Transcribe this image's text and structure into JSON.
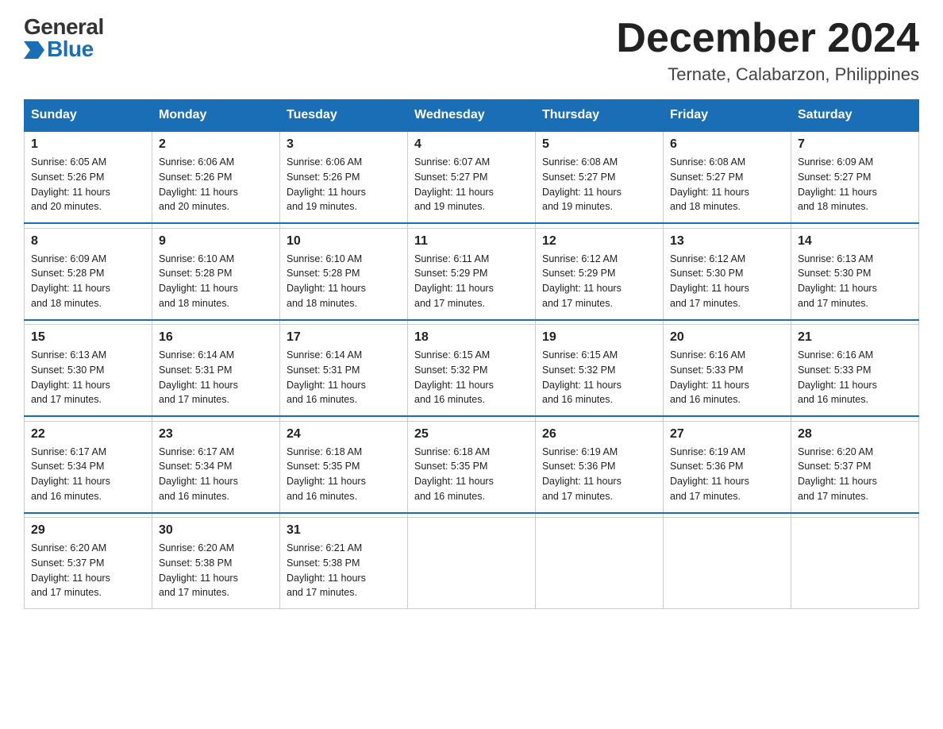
{
  "logo": {
    "general": "General",
    "blue": "Blue"
  },
  "title": "December 2024",
  "location": "Ternate, Calabarzon, Philippines",
  "days_of_week": [
    "Sunday",
    "Monday",
    "Tuesday",
    "Wednesday",
    "Thursday",
    "Friday",
    "Saturday"
  ],
  "weeks": [
    [
      {
        "num": "1",
        "sunrise": "6:05 AM",
        "sunset": "5:26 PM",
        "daylight": "11 hours and 20 minutes."
      },
      {
        "num": "2",
        "sunrise": "6:06 AM",
        "sunset": "5:26 PM",
        "daylight": "11 hours and 20 minutes."
      },
      {
        "num": "3",
        "sunrise": "6:06 AM",
        "sunset": "5:26 PM",
        "daylight": "11 hours and 19 minutes."
      },
      {
        "num": "4",
        "sunrise": "6:07 AM",
        "sunset": "5:27 PM",
        "daylight": "11 hours and 19 minutes."
      },
      {
        "num": "5",
        "sunrise": "6:08 AM",
        "sunset": "5:27 PM",
        "daylight": "11 hours and 19 minutes."
      },
      {
        "num": "6",
        "sunrise": "6:08 AM",
        "sunset": "5:27 PM",
        "daylight": "11 hours and 18 minutes."
      },
      {
        "num": "7",
        "sunrise": "6:09 AM",
        "sunset": "5:27 PM",
        "daylight": "11 hours and 18 minutes."
      }
    ],
    [
      {
        "num": "8",
        "sunrise": "6:09 AM",
        "sunset": "5:28 PM",
        "daylight": "11 hours and 18 minutes."
      },
      {
        "num": "9",
        "sunrise": "6:10 AM",
        "sunset": "5:28 PM",
        "daylight": "11 hours and 18 minutes."
      },
      {
        "num": "10",
        "sunrise": "6:10 AM",
        "sunset": "5:28 PM",
        "daylight": "11 hours and 18 minutes."
      },
      {
        "num": "11",
        "sunrise": "6:11 AM",
        "sunset": "5:29 PM",
        "daylight": "11 hours and 17 minutes."
      },
      {
        "num": "12",
        "sunrise": "6:12 AM",
        "sunset": "5:29 PM",
        "daylight": "11 hours and 17 minutes."
      },
      {
        "num": "13",
        "sunrise": "6:12 AM",
        "sunset": "5:30 PM",
        "daylight": "11 hours and 17 minutes."
      },
      {
        "num": "14",
        "sunrise": "6:13 AM",
        "sunset": "5:30 PM",
        "daylight": "11 hours and 17 minutes."
      }
    ],
    [
      {
        "num": "15",
        "sunrise": "6:13 AM",
        "sunset": "5:30 PM",
        "daylight": "11 hours and 17 minutes."
      },
      {
        "num": "16",
        "sunrise": "6:14 AM",
        "sunset": "5:31 PM",
        "daylight": "11 hours and 17 minutes."
      },
      {
        "num": "17",
        "sunrise": "6:14 AM",
        "sunset": "5:31 PM",
        "daylight": "11 hours and 16 minutes."
      },
      {
        "num": "18",
        "sunrise": "6:15 AM",
        "sunset": "5:32 PM",
        "daylight": "11 hours and 16 minutes."
      },
      {
        "num": "19",
        "sunrise": "6:15 AM",
        "sunset": "5:32 PM",
        "daylight": "11 hours and 16 minutes."
      },
      {
        "num": "20",
        "sunrise": "6:16 AM",
        "sunset": "5:33 PM",
        "daylight": "11 hours and 16 minutes."
      },
      {
        "num": "21",
        "sunrise": "6:16 AM",
        "sunset": "5:33 PM",
        "daylight": "11 hours and 16 minutes."
      }
    ],
    [
      {
        "num": "22",
        "sunrise": "6:17 AM",
        "sunset": "5:34 PM",
        "daylight": "11 hours and 16 minutes."
      },
      {
        "num": "23",
        "sunrise": "6:17 AM",
        "sunset": "5:34 PM",
        "daylight": "11 hours and 16 minutes."
      },
      {
        "num": "24",
        "sunrise": "6:18 AM",
        "sunset": "5:35 PM",
        "daylight": "11 hours and 16 minutes."
      },
      {
        "num": "25",
        "sunrise": "6:18 AM",
        "sunset": "5:35 PM",
        "daylight": "11 hours and 16 minutes."
      },
      {
        "num": "26",
        "sunrise": "6:19 AM",
        "sunset": "5:36 PM",
        "daylight": "11 hours and 17 minutes."
      },
      {
        "num": "27",
        "sunrise": "6:19 AM",
        "sunset": "5:36 PM",
        "daylight": "11 hours and 17 minutes."
      },
      {
        "num": "28",
        "sunrise": "6:20 AM",
        "sunset": "5:37 PM",
        "daylight": "11 hours and 17 minutes."
      }
    ],
    [
      {
        "num": "29",
        "sunrise": "6:20 AM",
        "sunset": "5:37 PM",
        "daylight": "11 hours and 17 minutes."
      },
      {
        "num": "30",
        "sunrise": "6:20 AM",
        "sunset": "5:38 PM",
        "daylight": "11 hours and 17 minutes."
      },
      {
        "num": "31",
        "sunrise": "6:21 AM",
        "sunset": "5:38 PM",
        "daylight": "11 hours and 17 minutes."
      },
      null,
      null,
      null,
      null
    ]
  ],
  "labels": {
    "sunrise": "Sunrise:",
    "sunset": "Sunset:",
    "daylight": "Daylight:"
  }
}
